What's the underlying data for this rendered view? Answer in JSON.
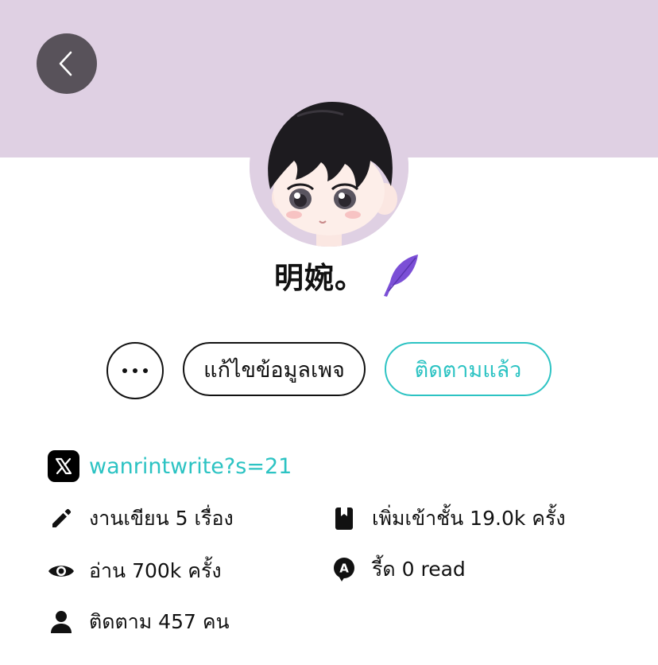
{
  "colors": {
    "banner": "#dfd0e3",
    "back_button": "#58525a",
    "accent": "#2cc3c3",
    "feather": "#7b4fd6",
    "text": "#111111"
  },
  "header": {
    "back_icon": "chevron-left-icon"
  },
  "profile": {
    "avatar": "avatar-illustration",
    "display_name": "明婉。",
    "badge_icon": "feather-icon"
  },
  "actions": {
    "more_icon": "more-horizontal-icon",
    "edit_page_label": "แก้ไขข้อมูลเพจ",
    "following_label": "ติดตามแล้ว"
  },
  "social": {
    "icon": "x-logo-icon",
    "handle": "wanrintwrite?s=21"
  },
  "stats": {
    "works": {
      "icon": "pencil-icon",
      "label": "งานเขียน 5 เรื่อง"
    },
    "bookmarks": {
      "icon": "book-icon",
      "label": "เพิ่มเข้าชั้น 19.0k ครั้ง"
    },
    "reads": {
      "icon": "eye-icon",
      "label": "อ่าน 700k ครั้ง"
    },
    "read_mode": {
      "icon": "chat-a-icon",
      "label": "รี้ด 0 read"
    },
    "followers": {
      "icon": "person-icon",
      "label": "ติดตาม 457 คน"
    }
  }
}
